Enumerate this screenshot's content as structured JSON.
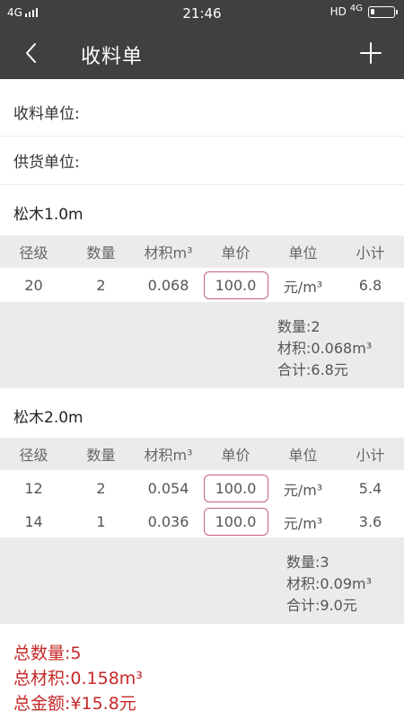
{
  "status_bar": {
    "network_left": "4G",
    "time": "21:46",
    "hd": "HD",
    "network_right": "4G"
  },
  "header": {
    "title": "收料单"
  },
  "fields": {
    "receiver_label": "收料单位:",
    "supplier_label": "供货单位:"
  },
  "table_columns": [
    "径级",
    "数量",
    "材积m³",
    "单价",
    "单位",
    "小计"
  ],
  "groups": [
    {
      "name": "松木1.0m",
      "rows": [
        {
          "diameter": "20",
          "quantity": "2",
          "volume": "0.068",
          "price": "100.0",
          "unit": "元/m³",
          "subtotal": "6.8"
        }
      ],
      "summary": {
        "quantity": "数量:2",
        "volume": "材积:0.068m³",
        "total": "合计:6.8元"
      }
    },
    {
      "name": "松木2.0m",
      "rows": [
        {
          "diameter": "12",
          "quantity": "2",
          "volume": "0.054",
          "price": "100.0",
          "unit": "元/m³",
          "subtotal": "5.4"
        },
        {
          "diameter": "14",
          "quantity": "1",
          "volume": "0.036",
          "price": "100.0",
          "unit": "元/m³",
          "subtotal": "3.6"
        }
      ],
      "summary": {
        "quantity": "数量:3",
        "volume": "材积:0.09m³",
        "total": "合计:9.0元"
      }
    }
  ],
  "totals": {
    "quantity": "总数量:5",
    "volume": "总材积:0.158m³",
    "amount": "总金额:¥15.8元"
  },
  "colors": {
    "bar": "#404040",
    "accent_border": "#c75c8c",
    "total_text": "#c62828",
    "header_bg": "#ebebeb"
  },
  "icons": {
    "back": "chevron-left-icon",
    "add": "plus-icon",
    "battery": "battery-icon",
    "signal": "signal-icon"
  }
}
